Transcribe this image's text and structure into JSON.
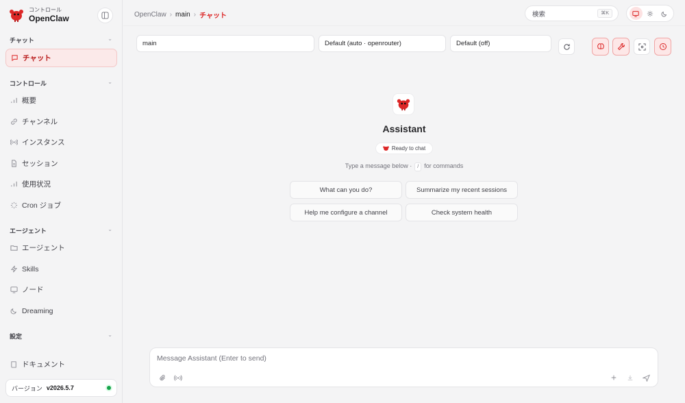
{
  "brand": {
    "subtitle": "コントロール",
    "name": "OpenClaw"
  },
  "sidebar": {
    "sections": {
      "chat": "チャット",
      "control": "コントロール",
      "agent": "エージェント",
      "settings": "設定"
    },
    "items": {
      "chat": "チャット",
      "overview": "概要",
      "channels": "チャンネル",
      "instances": "インスタンス",
      "sessions": "セッション",
      "usage": "使用状況",
      "cron": "Cron ジョブ",
      "agents": "エージェント",
      "skills": "Skills",
      "nodes": "ノード",
      "dreaming": "Dreaming",
      "docs": "ドキュメント"
    },
    "version_label": "バージョン",
    "version_value": "v2026.5.7"
  },
  "breadcrumb": {
    "root": "OpenClaw",
    "session": "main",
    "page": "チャット"
  },
  "search": {
    "label": "検索",
    "shortcut": "⌘K"
  },
  "toolbar": {
    "session": "main",
    "model": "Default (auto · openrouter)",
    "thinking": "Default (off)"
  },
  "assistant": {
    "name": "Assistant",
    "status": "Ready to chat",
    "hint_before": "Type a message below ·",
    "hint_key": "/",
    "hint_after": "for commands"
  },
  "suggestions": {
    "s1": "What can you do?",
    "s2": "Summarize my recent sessions",
    "s3": "Help me configure a channel",
    "s4": "Check system health"
  },
  "composer": {
    "placeholder": "Message Assistant (Enter to send)"
  },
  "colors": {
    "accent": "#dc2626",
    "status_online": "#16a34a"
  }
}
